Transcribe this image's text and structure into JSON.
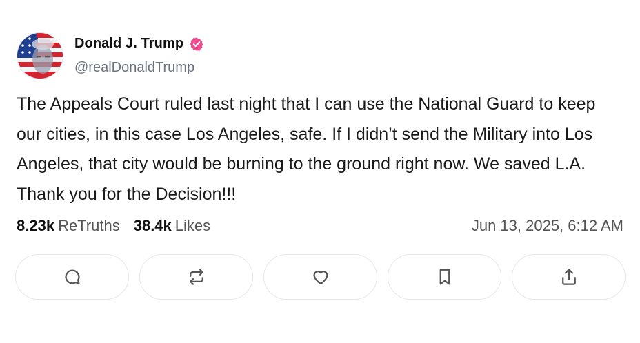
{
  "author": {
    "display_name": "Donald J. Trump",
    "handle": "@realDonaldTrump",
    "verified": true,
    "badge_color": "#ee4b8f"
  },
  "post": {
    "text": "The Appeals Court ruled last night that I can use the National Guard to keep our cities, in this case Los Angeles, safe. If I didn’t send the Military into Los Angeles, that city would be burning to the ground right now. We saved L.A. Thank you for the Decision!!!",
    "timestamp": "Jun 13, 2025, 6:12 AM"
  },
  "stats": {
    "retruths_count": "8.23k",
    "retruths_label": "ReTruths",
    "likes_count": "38.4k",
    "likes_label": "Likes"
  },
  "actions": [
    {
      "icon": "comment-icon"
    },
    {
      "icon": "retruth-icon"
    },
    {
      "icon": "heart-icon"
    },
    {
      "icon": "bookmark-icon"
    },
    {
      "icon": "share-icon"
    }
  ],
  "colors": {
    "text": "#111111",
    "muted": "#6b7280",
    "border": "#e5e7eb"
  }
}
